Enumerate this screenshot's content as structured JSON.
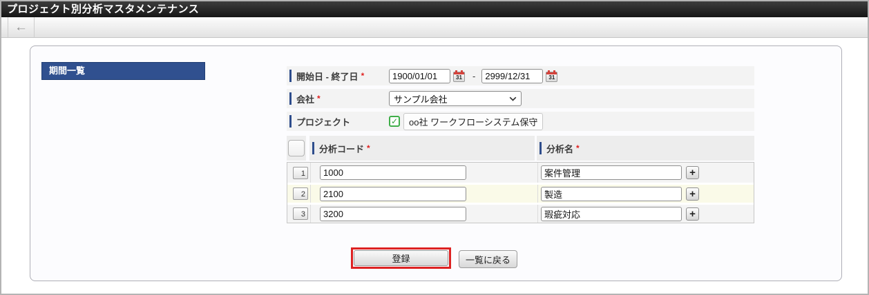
{
  "window": {
    "title": "プロジェクト別分析マスタメンテナンス"
  },
  "icons": {
    "back_arrow": "←",
    "calendar_day": "31",
    "check": "✓",
    "add": "+"
  },
  "panel": {
    "section_title": "期間一覧"
  },
  "form": {
    "required_mark": "*",
    "date_row": {
      "label": "開始日 - 終了日",
      "start_value": "1900/01/01",
      "separator": "-",
      "end_value": "2999/12/31"
    },
    "company_row": {
      "label": "会社",
      "selected": "サンプル会社"
    },
    "project_row": {
      "label": "プロジェクト",
      "value": "oo社 ワークフローシステム保守"
    }
  },
  "table": {
    "col_code": {
      "label": "分析コード"
    },
    "col_name": {
      "label": "分析名"
    },
    "rows": [
      {
        "no": "1",
        "code": "1000",
        "name": "案件管理"
      },
      {
        "no": "2",
        "code": "2100",
        "name": "製造"
      },
      {
        "no": "3",
        "code": "3200",
        "name": "瑕疵対応"
      }
    ]
  },
  "actions": {
    "register": "登録",
    "back_to_list": "一覧に戻る"
  },
  "colors": {
    "accent_blue": "#2e4d8c",
    "section_blue": "#30508f",
    "highlight_red": "#dd2222",
    "row_alt_yellow": "#fafae8",
    "titlebar_black": "#1b1b1b"
  }
}
